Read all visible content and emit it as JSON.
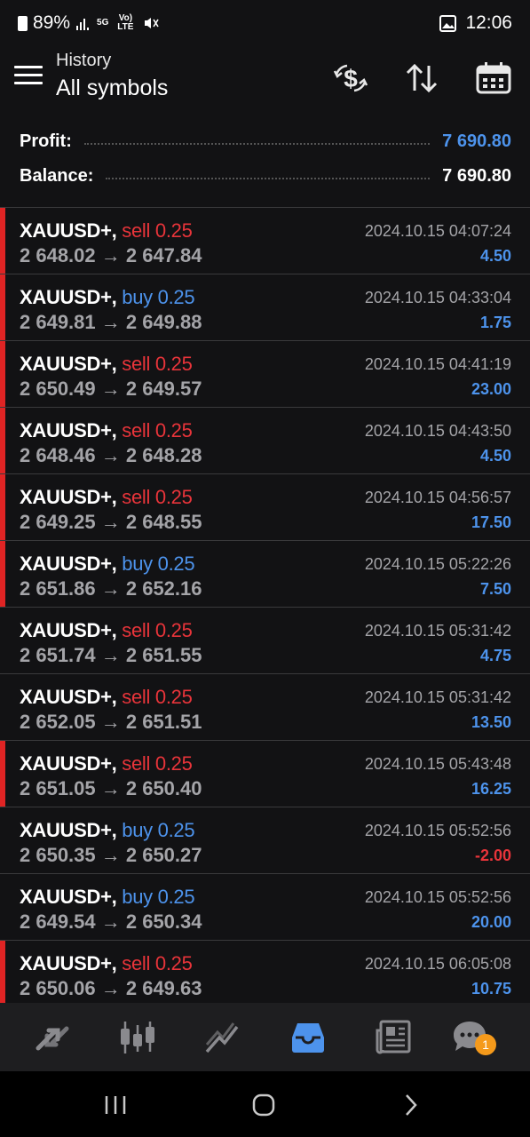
{
  "status": {
    "battery": "89%",
    "network": "5G",
    "volte": "Vo) LTE",
    "time": "12:06"
  },
  "header": {
    "subtitle": "History",
    "title": "All symbols"
  },
  "summary": {
    "profit_label": "Profit:",
    "profit_value": "7 690.80",
    "balance_label": "Balance:",
    "balance_value": "7 690.80"
  },
  "trades": [
    {
      "symbol": "XAUUSD+,",
      "side": "sell",
      "volume": "sell 0.25",
      "prices": "2 648.02 → 2 647.84",
      "time": "2024.10.15 04:07:24",
      "profit": "4.50",
      "marked": true
    },
    {
      "symbol": "XAUUSD+,",
      "side": "buy",
      "volume": "buy 0.25",
      "prices": "2 649.81 → 2 649.88",
      "time": "2024.10.15 04:33:04",
      "profit": "1.75",
      "marked": true
    },
    {
      "symbol": "XAUUSD+,",
      "side": "sell",
      "volume": "sell 0.25",
      "prices": "2 650.49 → 2 649.57",
      "time": "2024.10.15 04:41:19",
      "profit": "23.00",
      "marked": true
    },
    {
      "symbol": "XAUUSD+,",
      "side": "sell",
      "volume": "sell 0.25",
      "prices": "2 648.46 → 2 648.28",
      "time": "2024.10.15 04:43:50",
      "profit": "4.50",
      "marked": true
    },
    {
      "symbol": "XAUUSD+,",
      "side": "sell",
      "volume": "sell 0.25",
      "prices": "2 649.25 → 2 648.55",
      "time": "2024.10.15 04:56:57",
      "profit": "17.50",
      "marked": true
    },
    {
      "symbol": "XAUUSD+,",
      "side": "buy",
      "volume": "buy 0.25",
      "prices": "2 651.86 → 2 652.16",
      "time": "2024.10.15 05:22:26",
      "profit": "7.50",
      "marked": true
    },
    {
      "symbol": "XAUUSD+,",
      "side": "sell",
      "volume": "sell 0.25",
      "prices": "2 651.74 → 2 651.55",
      "time": "2024.10.15 05:31:42",
      "profit": "4.75",
      "marked": false
    },
    {
      "symbol": "XAUUSD+,",
      "side": "sell",
      "volume": "sell 0.25",
      "prices": "2 652.05 → 2 651.51",
      "time": "2024.10.15 05:31:42",
      "profit": "13.50",
      "marked": false
    },
    {
      "symbol": "XAUUSD+,",
      "side": "sell",
      "volume": "sell 0.25",
      "prices": "2 651.05 → 2 650.40",
      "time": "2024.10.15 05:43:48",
      "profit": "16.25",
      "marked": true
    },
    {
      "symbol": "XAUUSD+,",
      "side": "buy",
      "volume": "buy 0.25",
      "prices": "2 650.35 → 2 650.27",
      "time": "2024.10.15 05:52:56",
      "profit": "-2.00",
      "marked": false
    },
    {
      "symbol": "XAUUSD+,",
      "side": "buy",
      "volume": "buy 0.25",
      "prices": "2 649.54 → 2 650.34",
      "time": "2024.10.15 05:52:56",
      "profit": "20.00",
      "marked": false
    },
    {
      "symbol": "XAUUSD+,",
      "side": "sell",
      "volume": "sell 0.25",
      "prices": "2 650.06 → 2 649.63",
      "time": "2024.10.15 06:05:08",
      "profit": "10.75",
      "marked": true
    }
  ],
  "tabs": [
    {
      "icon": "quotes-icon",
      "active": false
    },
    {
      "icon": "chart-icon",
      "active": false
    },
    {
      "icon": "trade-icon",
      "active": false
    },
    {
      "icon": "history-icon",
      "active": true
    },
    {
      "icon": "news-icon",
      "active": false
    },
    {
      "icon": "chat-icon",
      "active": false
    }
  ],
  "chat_badge": "1",
  "colors": {
    "sell": "#e8343a",
    "buy": "#4d93ec",
    "accent": "#4d93ec",
    "badge": "#f59a1b"
  }
}
